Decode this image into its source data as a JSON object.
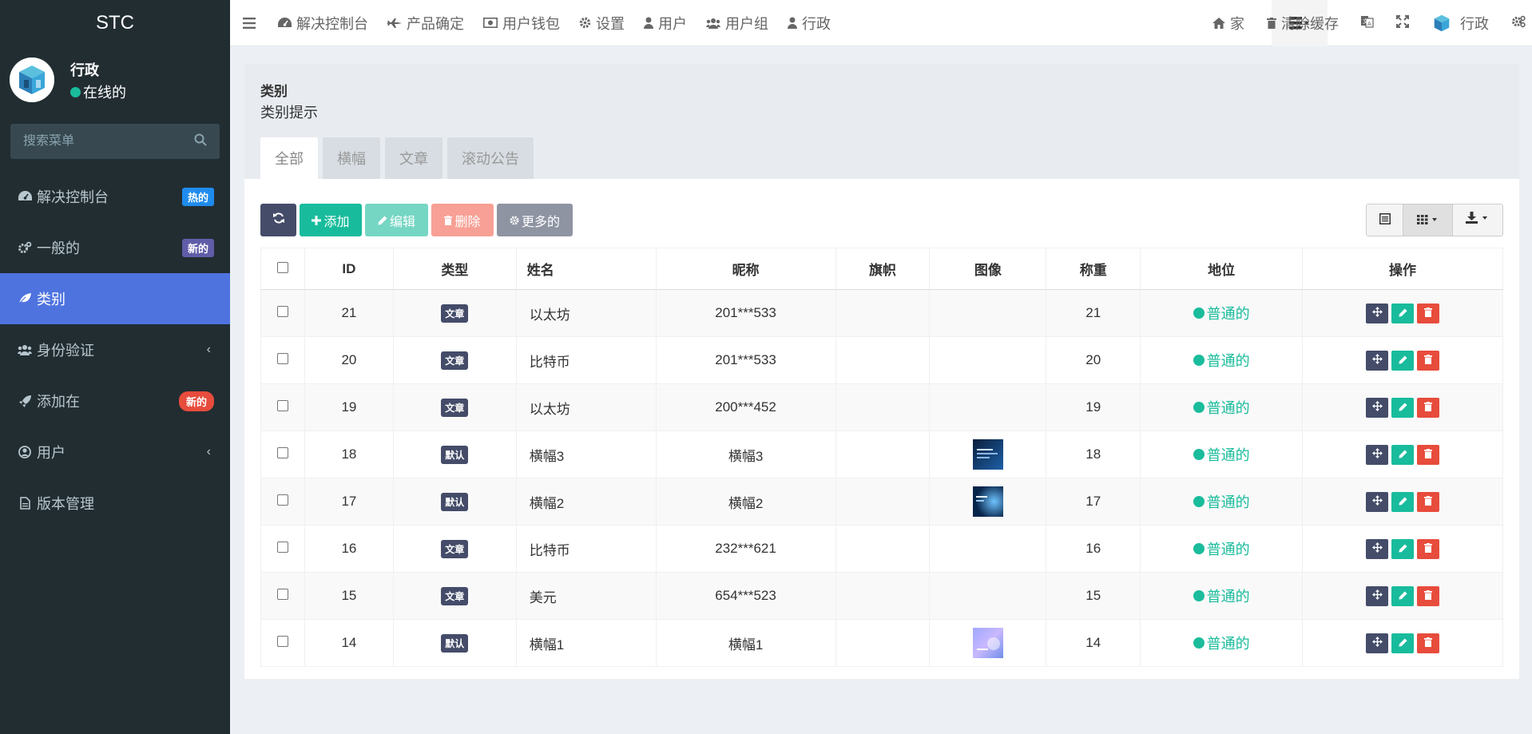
{
  "brand": "STC",
  "user": {
    "name": "行政",
    "status": "在线的"
  },
  "search": {
    "placeholder": "搜索菜单"
  },
  "menu": [
    {
      "label": "解决控制台",
      "icon": "dashboard-icon",
      "badge": "热的",
      "badge_color": "#1f8ced"
    },
    {
      "label": "一般的",
      "icon": "cogs-icon",
      "badge": "新的",
      "badge_color": "#605ca8"
    },
    {
      "label": "类别",
      "icon": "leaf-icon",
      "active": true
    },
    {
      "label": "身份验证",
      "icon": "users-icon",
      "chevron": "‹"
    },
    {
      "label": "添加在",
      "icon": "rocket-icon",
      "badge": "新的",
      "badge_color": "#e74c3c"
    },
    {
      "label": "用户",
      "icon": "user-circle-icon",
      "chevron": "‹"
    },
    {
      "label": "版本管理",
      "icon": "file-icon"
    }
  ],
  "topnav": {
    "items": [
      {
        "label": "解决控制台",
        "icon": "dashboard-icon"
      },
      {
        "label": "产品确定",
        "icon": "plane-icon"
      },
      {
        "label": "用户钱包",
        "icon": "money-icon"
      },
      {
        "label": "设置",
        "icon": "gear-icon"
      },
      {
        "label": "用户",
        "icon": "user-icon"
      },
      {
        "label": "用户组",
        "icon": "users-icon"
      },
      {
        "label": "行政",
        "icon": "user-icon"
      }
    ],
    "home": "家",
    "clear_cache": "清除缓存",
    "admin": "行政"
  },
  "panel": {
    "title": "类别",
    "subtitle": "类别提示"
  },
  "tabs": [
    "全部",
    "横幅",
    "文章",
    "滚动公告"
  ],
  "toolbar": {
    "add": "添加",
    "edit": "编辑",
    "delete": "删除",
    "more": "更多的"
  },
  "table": {
    "headers": [
      "ID",
      "类型",
      "姓名",
      "昵称",
      "旗帜",
      "图像",
      "称重",
      "地位",
      "操作"
    ],
    "rows": [
      {
        "id": "21",
        "type": "文章",
        "name": "以太坊",
        "nick": "201***533",
        "flag": "",
        "image": "",
        "weight": "21",
        "status": "普通的"
      },
      {
        "id": "20",
        "type": "文章",
        "name": "比特币",
        "nick": "201***533",
        "flag": "",
        "image": "",
        "weight": "20",
        "status": "普通的"
      },
      {
        "id": "19",
        "type": "文章",
        "name": "以太坊",
        "nick": "200***452",
        "flag": "",
        "image": "",
        "weight": "19",
        "status": "普通的"
      },
      {
        "id": "18",
        "type": "默认",
        "name": "横幅3",
        "nick": "横幅3",
        "flag": "",
        "image": "banner-dark",
        "weight": "18",
        "status": "普通的"
      },
      {
        "id": "17",
        "type": "默认",
        "name": "横幅2",
        "nick": "横幅2",
        "flag": "",
        "image": "banner-blue",
        "weight": "17",
        "status": "普通的"
      },
      {
        "id": "16",
        "type": "文章",
        "name": "比特币",
        "nick": "232***621",
        "flag": "",
        "image": "",
        "weight": "16",
        "status": "普通的"
      },
      {
        "id": "15",
        "type": "文章",
        "name": "美元",
        "nick": "654***523",
        "flag": "",
        "image": "",
        "weight": "15",
        "status": "普通的"
      },
      {
        "id": "14",
        "type": "默认",
        "name": "横幅1",
        "nick": "横幅1",
        "flag": "",
        "image": "banner-light",
        "weight": "14",
        "status": "普通的"
      }
    ]
  },
  "colors": {
    "sidebar": "#222d32",
    "active": "#4e73df",
    "success": "#18bc9c",
    "danger": "#e74c3c",
    "primary": "#444c69"
  }
}
